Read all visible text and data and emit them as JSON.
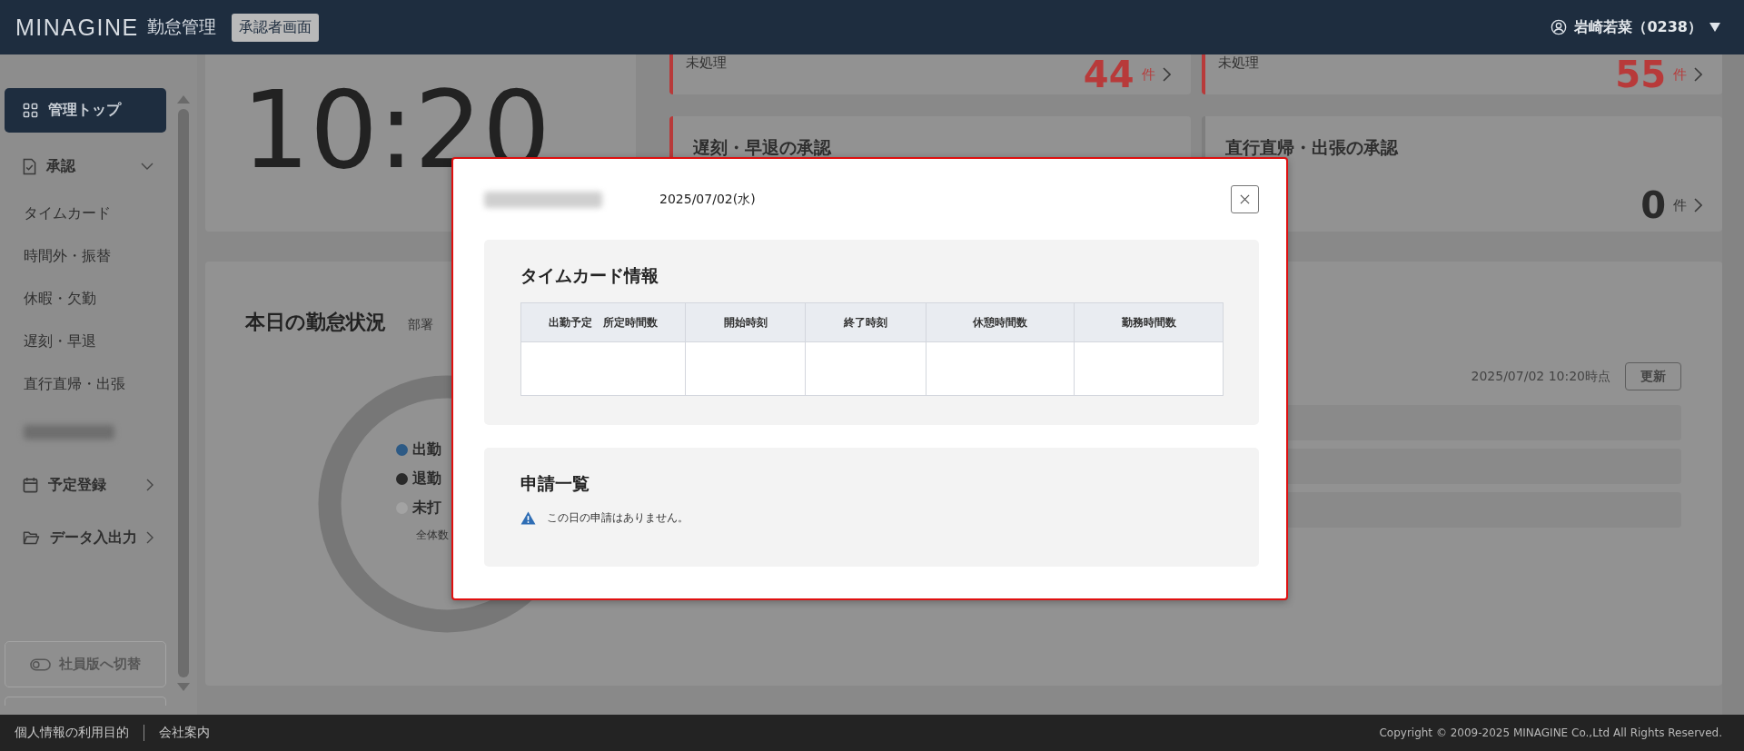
{
  "header": {
    "logo": "MINAGINE",
    "app_name": "勤怠管理",
    "mode_badge": "承認者画面",
    "user": "岩崎若菜（0238）"
  },
  "sidebar": {
    "items": [
      {
        "kind": "grid",
        "label": "管理トップ",
        "selected": true
      },
      {
        "kind": "document",
        "label": "承認",
        "selected": false,
        "expanded": true
      },
      {
        "kind": "sub",
        "label": "タイムカード",
        "selected": false
      },
      {
        "kind": "sub",
        "label": "時間外・振替",
        "selected": false
      },
      {
        "kind": "sub",
        "label": "休暇・欠勤",
        "selected": false
      },
      {
        "kind": "sub",
        "label": "遅刻・早退",
        "selected": false
      },
      {
        "kind": "sub",
        "label": "直行直帰・出張",
        "selected": false
      },
      {
        "kind": "redacted",
        "selected": false
      },
      {
        "kind": "calendar",
        "label": "予定登録",
        "selected": false,
        "expanded": false
      },
      {
        "kind": "folder",
        "label": "データ入出力",
        "selected": false,
        "expanded": false
      }
    ],
    "switch_button": "社員版へ切替"
  },
  "clock": {
    "time": "10:20"
  },
  "pending_cards": [
    {
      "label": "未処理",
      "count": "44",
      "unit": "件",
      "pending": true
    },
    {
      "label": "未処理",
      "count": "55",
      "unit": "件",
      "pending": true
    }
  ],
  "approval_cards": [
    {
      "title": "遅刻・早退の承認",
      "pending": true
    },
    {
      "title": "直行直帰・出張の承認",
      "count": "0",
      "unit": "件",
      "pending": false
    }
  ],
  "status": {
    "title": "本日の勤怠状況",
    "filter_label": "部署",
    "legend": [
      {
        "label": "出勤",
        "color": "#2d5a85"
      },
      {
        "label": "退勤",
        "color": "#2a2a2a"
      },
      {
        "label": "未打",
        "color": "#a3a3a3"
      }
    ],
    "total_label": "全体数",
    "updated": "2025/07/02 10:20時点",
    "refresh_button": "更新"
  },
  "modal": {
    "date": "2025/07/02(水)",
    "timecard": {
      "title": "タイムカード情報",
      "columns": [
        "出勤予定　所定時間数",
        "開始時刻",
        "終了時刻",
        "休憩時間数",
        "勤務時間数"
      ]
    },
    "applications": {
      "title": "申請一覧",
      "notice": "この日の申請はありません。"
    }
  },
  "footer": {
    "links": [
      "個人情報の利用目的",
      "会社案内"
    ],
    "copyright": "Copyright © 2009-2025 MINAGINE Co.,Ltd All Rights Reserved."
  }
}
